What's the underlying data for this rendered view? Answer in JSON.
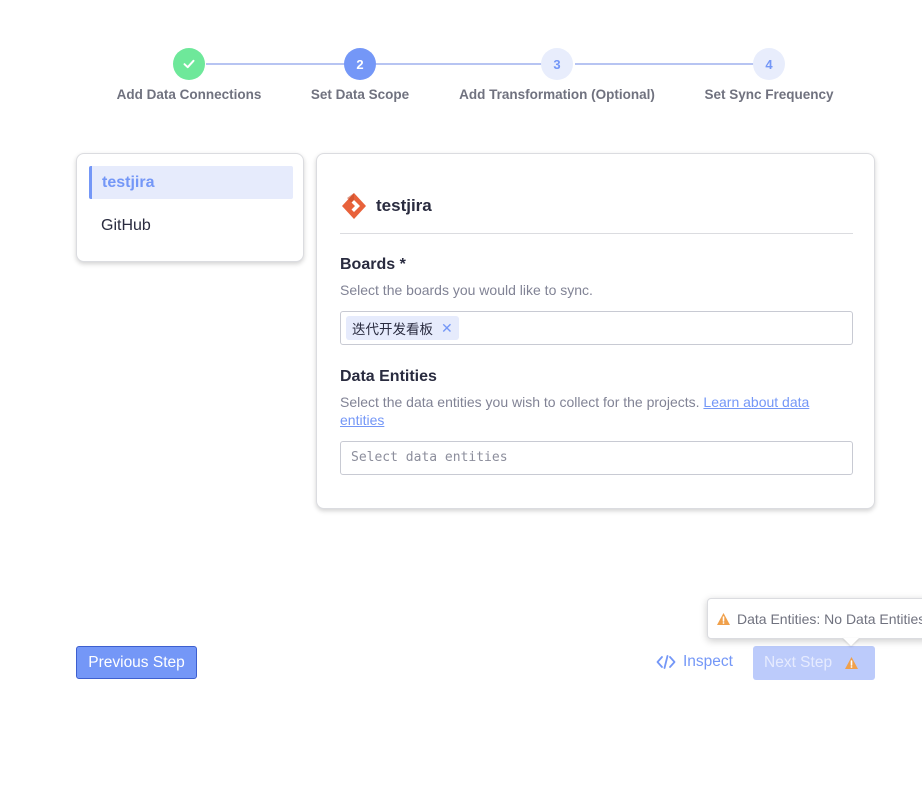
{
  "stepper": {
    "steps": [
      {
        "number": "1",
        "label": "Add Data Connections",
        "status": "done"
      },
      {
        "number": "2",
        "label": "Set Data Scope",
        "status": "active"
      },
      {
        "number": "3",
        "label": "Add Transformation (Optional)",
        "status": "pending"
      },
      {
        "number": "4",
        "label": "Set Sync Frequency",
        "status": "pending"
      }
    ],
    "colors": {
      "done": "#6ee89a",
      "active": "#7497f7",
      "pending": "#e8edfc",
      "line": "#b7c4f2"
    }
  },
  "sidebar": {
    "items": [
      {
        "label": "testjira",
        "active": true
      },
      {
        "label": "GitHub",
        "active": false
      }
    ]
  },
  "panel": {
    "connection_name": "testjira",
    "connection_icon": "jira-icon",
    "boards": {
      "title": "Boards *",
      "description": "Select the boards you would like to sync.",
      "selected": [
        "迭代开发看板"
      ]
    },
    "data_entities": {
      "title": "Data Entities",
      "description": "Select the data entities you wish to collect for the projects.",
      "link_text": "Learn about data entities",
      "placeholder": "Select data entities"
    }
  },
  "footer": {
    "previous_label": "Previous Step",
    "inspect_label": "Inspect",
    "next_label": "Next Step",
    "tooltip_text": "Data Entities: No Data Entities Selected"
  },
  "colors": {
    "accent": "#7497f7",
    "warning": "#f0a04b",
    "jira_orange": "#e8623b"
  }
}
